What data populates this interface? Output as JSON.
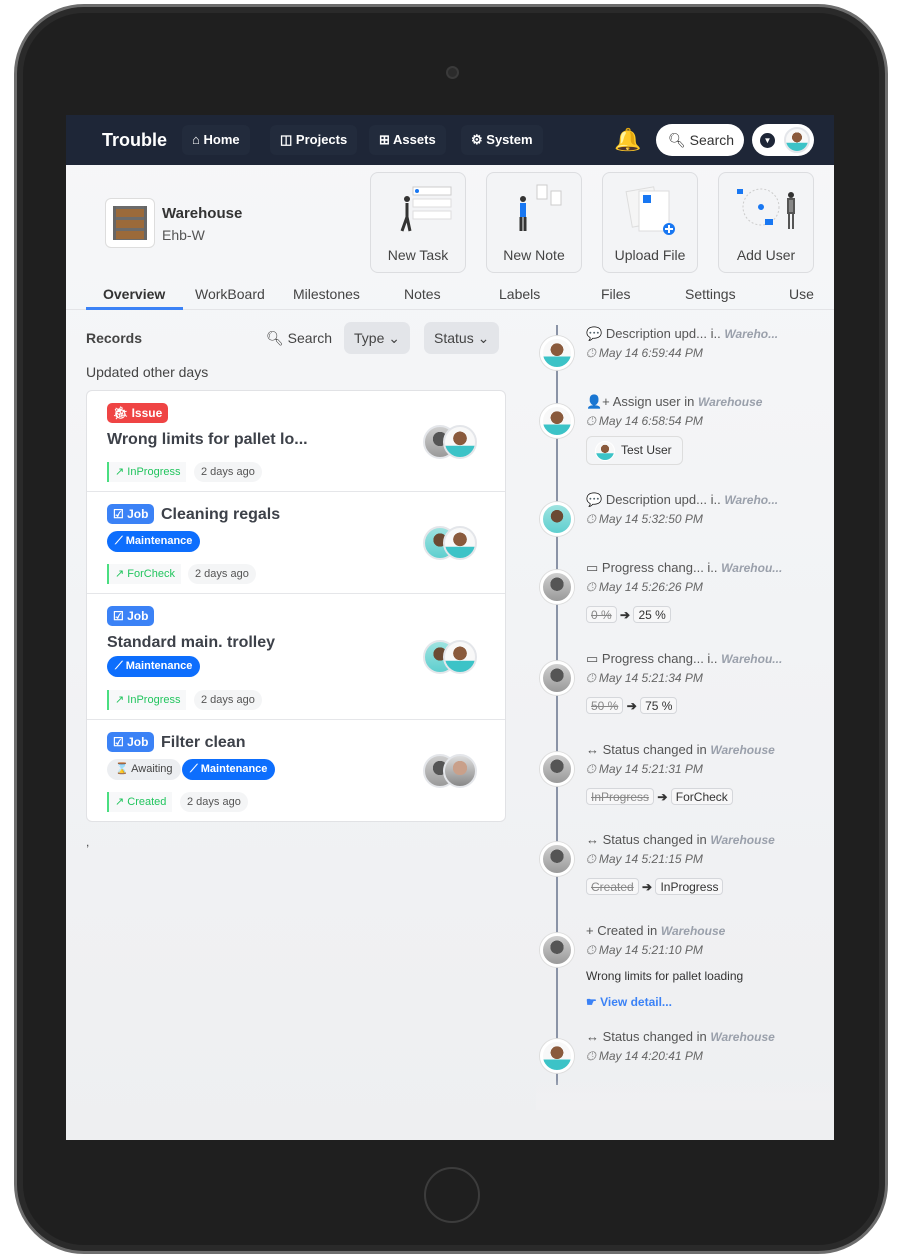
{
  "nav": {
    "brand": "Trouble",
    "items": [
      {
        "label": "Home",
        "icon": "⌂"
      },
      {
        "label": "Projects",
        "icon": "◫"
      },
      {
        "label": "Assets",
        "icon": "⊞"
      },
      {
        "label": "System",
        "icon": "⚙"
      }
    ],
    "search": "Search"
  },
  "project": {
    "name": "Warehouse",
    "code": "Ehb-W"
  },
  "actions": [
    "New Task",
    "New Note",
    "Upload File",
    "Add User"
  ],
  "tabs": [
    "Overview",
    "WorkBoard",
    "Milestones",
    "Notes",
    "Labels",
    "Files",
    "Settings",
    "Users"
  ],
  "records": {
    "title": "Records",
    "search": "Search",
    "type": "Type",
    "status": "Status",
    "subheading": "Updated other days",
    "footer": ",",
    "items": [
      {
        "badge": "Issue",
        "title": "Wrong limits for pallet lo...",
        "tags": [],
        "status": "InProgress",
        "ago": "2 days ago"
      },
      {
        "badge": "Job",
        "title": "Cleaning regals",
        "tags": [
          "Maintenance"
        ],
        "status": "ForCheck",
        "ago": "2 days ago"
      },
      {
        "badge": "Job",
        "title": "Standard main. trolley",
        "tags": [
          "Maintenance"
        ],
        "status": "InProgress",
        "ago": "2 days ago"
      },
      {
        "badge": "Job",
        "title": "Filter clean",
        "tags": [
          "Awaiting",
          "Maintenance"
        ],
        "status": "Created",
        "ago": "2 days ago"
      }
    ]
  },
  "timeline": [
    {
      "action": "Description upd...  i..",
      "project": "Wareho...",
      "time": "May 14 6:59:44 PM"
    },
    {
      "action": "Assign user in",
      "project": "Warehouse",
      "time": "May 14 6:58:54 PM",
      "user": "Test User"
    },
    {
      "action": "Description upd...  i..",
      "project": "Wareho...",
      "time": "May 14 5:32:50 PM"
    },
    {
      "action": "Progress chang...  i..",
      "project": "Warehou...",
      "time": "May 14 5:26:26 PM",
      "from": "0 %",
      "to": "25 %"
    },
    {
      "action": "Progress chang...  i..",
      "project": "Warehou...",
      "time": "May 14 5:21:34 PM",
      "from": "50 %",
      "to": "75 %"
    },
    {
      "action": "Status changed in",
      "project": "Warehouse",
      "time": "May 14 5:21:31 PM",
      "from": "InProgress",
      "to": "ForCheck"
    },
    {
      "action": "Status changed in",
      "project": "Warehouse",
      "time": "May 14 5:21:15 PM",
      "from": "Created",
      "to": "InProgress"
    },
    {
      "action": "Created in",
      "project": "Warehouse",
      "time": "May 14 5:21:10 PM",
      "text": "Wrong limits for pallet loading",
      "link": "View detail..."
    },
    {
      "action": "Status changed in",
      "project": "Warehouse",
      "time": "May 14 4:20:41 PM"
    }
  ]
}
